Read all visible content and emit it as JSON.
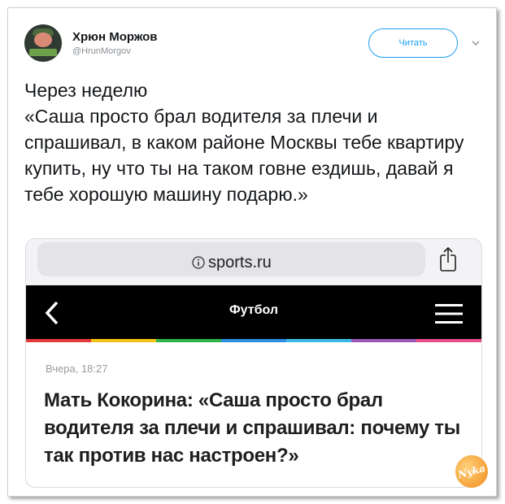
{
  "tweet": {
    "author_name": "Хрюн Моржов",
    "author_handle": "@HrunMorgov",
    "follow_label": "Читать",
    "text": "Через неделю\n«Саша просто брал водителя за плечи и спрашивал, в каком районе Москвы тебе квартиру купить, ну что ты на таком говне ездишь, давай я тебе хорошую машину подарю.»"
  },
  "screenshot": {
    "url": "sports.ru",
    "nav_title": "Футбол",
    "date": "Вчера, 18:27",
    "headline": "Мать Кокорина: «Саша просто брал водителя за плечи и спрашивал: почему ты так против нас настроен?»",
    "stripe_colors": [
      "#e23a3a",
      "#f0c419",
      "#2db34a",
      "#2f8de0",
      "#3bb9e6",
      "#9b59b6",
      "#e84c8a"
    ]
  },
  "watermark": {
    "text": "Nyka"
  },
  "icons": [
    "avatar",
    "chevron-down-icon",
    "info-icon",
    "share-icon",
    "back-arrow-icon",
    "hamburger-menu-icon"
  ]
}
